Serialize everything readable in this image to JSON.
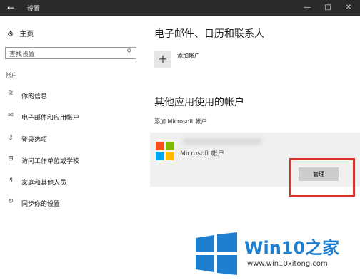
{
  "titlebar": {
    "back_icon": "arrow-left-icon",
    "title": "设置",
    "minimize": "—",
    "maximize": "□",
    "close": "✕"
  },
  "sidebar": {
    "home_icon": "gear-icon",
    "home": "主页",
    "search_placeholder": "查找设置",
    "section_title": "帐户",
    "items": [
      {
        "icon": "person-info-icon",
        "label": "你的信息"
      },
      {
        "icon": "mail-icon",
        "label": "电子邮件和应用帐户"
      },
      {
        "icon": "key-icon",
        "label": "登录选项"
      },
      {
        "icon": "briefcase-icon",
        "label": "访问工作单位或学校"
      },
      {
        "icon": "person-add-icon",
        "label": "家庭和其他人员"
      },
      {
        "icon": "sync-icon",
        "label": "同步你的设置"
      }
    ]
  },
  "content": {
    "heading1": "电子邮件、日历和联系人",
    "add_account": "添加帐户",
    "heading2": "其他应用使用的帐户",
    "add_ms_account": "添加 Microsoft 帐户",
    "account_name": "Microsoft 帐户",
    "manage_button": "管理"
  },
  "watermark": {
    "text_win": "Win10",
    "text_zh": "之家",
    "url": "www.win10xitong.com"
  },
  "colors": {
    "titlebar": "#2b2b2b",
    "highlight": "#d9322e",
    "brand_blue": "#1e7fd0"
  }
}
